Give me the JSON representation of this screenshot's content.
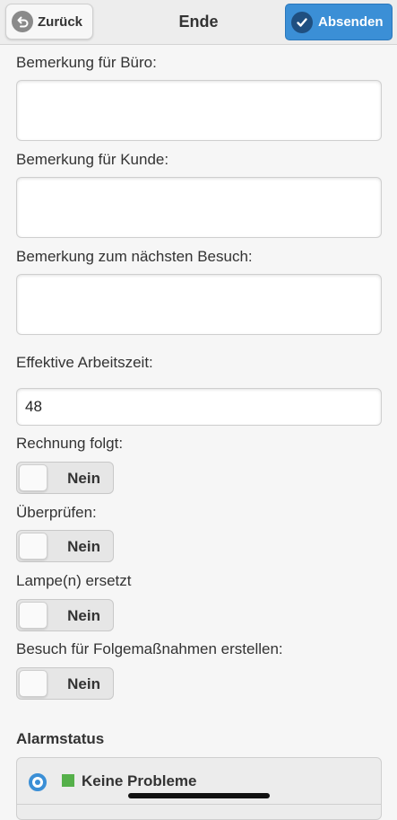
{
  "header": {
    "back_label": "Zurück",
    "title": "Ende",
    "submit_label": "Absenden"
  },
  "form": {
    "bemerkung_buero_label": "Bemerkung für Büro:",
    "bemerkung_kunde_label": "Bemerkung für Kunde:",
    "bemerkung_besuch_label": "Bemerkung zum nächsten Besuch:",
    "arbeitszeit_label": "Effektive Arbeitszeit:",
    "arbeitszeit_value": "48",
    "rechnung_label": "Rechnung folgt:",
    "rechnung_value": "Nein",
    "pruefen_label": "Überprüfen:",
    "pruefen_value": "Nein",
    "lampe_label": "Lampe(n) ersetzt",
    "lampe_value": "Nein",
    "folge_label": "Besuch für Folgemaßnahmen erstellen:",
    "folge_value": "Nein"
  },
  "alarm": {
    "title": "Alarmstatus",
    "selected_option": "Keine Probleme",
    "status_color": "#55b04a"
  },
  "colors": {
    "accent": "#3b8fd6",
    "background": "#f6f6f6"
  },
  "icons": {
    "back": "undo-arrow-icon",
    "submit": "checkmark-icon"
  }
}
